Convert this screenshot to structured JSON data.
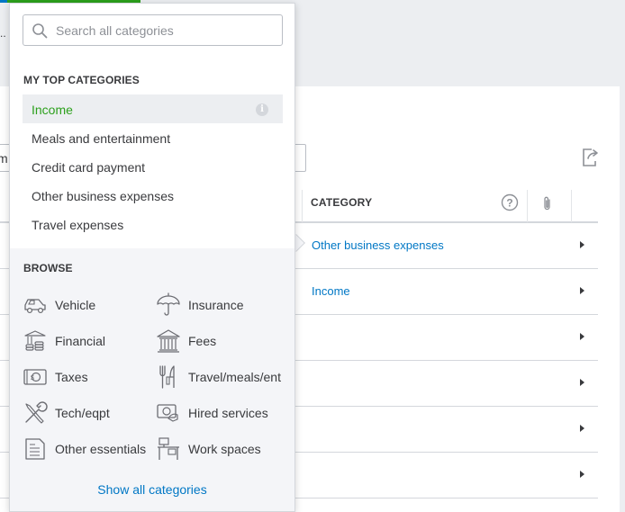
{
  "background": {
    "truncated_text": "..",
    "filter_prefix": "m",
    "table": {
      "category_header": "CATEGORY",
      "rows": [
        {
          "category": "Other business expenses"
        },
        {
          "category": "Income"
        },
        {
          "category": ""
        },
        {
          "category": ""
        },
        {
          "category": ""
        },
        {
          "category": ""
        }
      ]
    }
  },
  "dropdown": {
    "search": {
      "placeholder": "Search all categories",
      "value": ""
    },
    "top_categories": {
      "title": "MY TOP CATEGORIES",
      "items": [
        {
          "label": "Income",
          "active": true
        },
        {
          "label": "Meals and entertainment"
        },
        {
          "label": "Credit card payment"
        },
        {
          "label": "Other business expenses"
        },
        {
          "label": "Travel expenses"
        }
      ]
    },
    "browse": {
      "title": "BROWSE",
      "items": [
        {
          "label": "Vehicle",
          "icon": "car-icon"
        },
        {
          "label": "Insurance",
          "icon": "umbrella-icon"
        },
        {
          "label": "Financial",
          "icon": "coins-icon"
        },
        {
          "label": "Fees",
          "icon": "bank-icon"
        },
        {
          "label": "Taxes",
          "icon": "money-icon"
        },
        {
          "label": "Travel/meals/ent",
          "icon": "utensils-icon"
        },
        {
          "label": "Tech/eqpt",
          "icon": "tools-icon"
        },
        {
          "label": "Hired services",
          "icon": "hired-services-icon"
        },
        {
          "label": "Other essentials",
          "icon": "document-icon"
        },
        {
          "label": "Work spaces",
          "icon": "desk-icon"
        }
      ]
    },
    "show_all_label": "Show all categories"
  },
  "colors": {
    "accent_green": "#2ca01c",
    "link_blue": "#0077c5",
    "text": "#393a3d"
  }
}
